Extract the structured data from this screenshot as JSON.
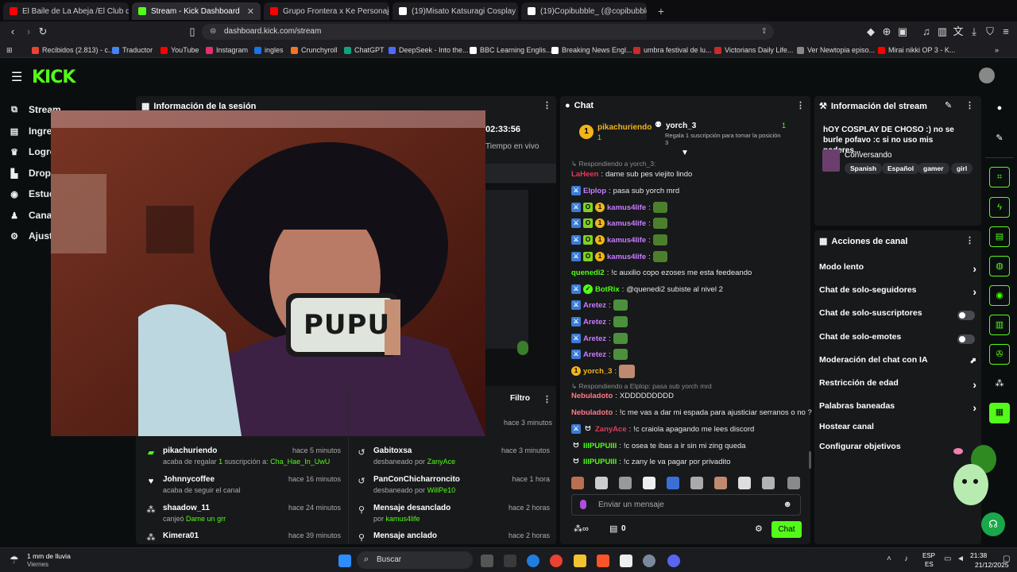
{
  "browser": {
    "tabs": [
      {
        "title": "El Baile de La Abeja /El Club de Kids",
        "icon": "youtube-icon",
        "color": "#ff0000"
      },
      {
        "title": "Stream - Kick Dashboard",
        "icon": "kick-icon",
        "color": "#53fc18"
      },
      {
        "title": "Grupo Frontera x Ke Personajes",
        "icon": "youtube-icon",
        "color": "#ff0000"
      },
      {
        "title": "(19)Misato Katsuragi Cosplay Highlig",
        "icon": "tiktok-icon",
        "color": "#ffffff"
      },
      {
        "title": "(19)Copibubble_ (@copibubble_) | T",
        "icon": "tiktok-icon",
        "color": "#ffffff"
      }
    ],
    "url": "dashboard.kick.com/stream",
    "bookmarks": [
      {
        "label": "Recibidos (2.813) - c...",
        "color": "#ea4335"
      },
      {
        "label": "Traductor",
        "color": "#4285f4"
      },
      {
        "label": "YouTube",
        "color": "#ff0000"
      },
      {
        "label": "Instagram",
        "color": "#e1306c"
      },
      {
        "label": "ingles",
        "color": "#1a73e8"
      },
      {
        "label": "Crunchyroll",
        "color": "#f47521"
      },
      {
        "label": "ChatGPT",
        "color": "#10a37f"
      },
      {
        "label": "DeepSeek - Into the...",
        "color": "#4d6bfe"
      },
      {
        "label": "BBC Learning Englis...",
        "color": "#ffffff"
      },
      {
        "label": "Breaking News Engl...",
        "color": "#ffffff"
      },
      {
        "label": "umbra festival de lu...",
        "color": "#c92a2a"
      },
      {
        "label": "Victorians Daily Life...",
        "color": "#c92a2a"
      },
      {
        "label": "Ver Newtopia episo...",
        "color": "#888888"
      },
      {
        "label": "Mirai nikki OP 3 - K...",
        "color": "#ff0000"
      }
    ]
  },
  "kick": {
    "logo": "KICK",
    "sidebar": [
      {
        "label": "Stream",
        "icon": "stream-icon"
      },
      {
        "label": "Ingres",
        "icon": "dollar-icon"
      },
      {
        "label": "Logro",
        "icon": "trophy-icon"
      },
      {
        "label": "Drops",
        "icon": "drops-icon"
      },
      {
        "label": "Estud",
        "icon": "studio-icon"
      },
      {
        "label": "Canal",
        "icon": "channel-icon"
      },
      {
        "label": "Ajust",
        "icon": "gear-icon"
      }
    ],
    "session": {
      "title": "Información de la sesión",
      "time": "02:33:56",
      "live_label": "Tiempo en vivo"
    },
    "overlay_text": "PUPU",
    "events": [
      {
        "name": "pikachuriendo",
        "time": "hace 5 minutos",
        "sub": "acaba de regalar",
        "highlight": "1",
        "sub2": "suscripción a:",
        "target": "Cha_Hae_In_UwU",
        "icon": "gift-icon"
      },
      {
        "name": "Johnnycoffee",
        "time": "hace 16 minutos",
        "sub": "acaba de seguir el canal",
        "icon": "heart-icon"
      },
      {
        "name": "shaadow_11",
        "time": "hace 24 minutos",
        "sub": "canjeó",
        "target": "Dame un grr",
        "icon": "redeem-icon"
      },
      {
        "name": "Kimera01",
        "time": "hace 39 minutos",
        "icon": "redeem-icon"
      }
    ],
    "mod_log": {
      "filter_label": "Filtro",
      "top_time": "hace 3 minutos",
      "rows": [
        {
          "name": "Gabitoxsa",
          "time": "hace 3 minutos",
          "sub": "desbaneado por",
          "by": "ZanyAce",
          "icon": "undo-icon"
        },
        {
          "name": "PanConChicharroncito",
          "time": "hace 1 hora",
          "sub": "desbaneado por",
          "by": "WillPe10",
          "icon": "undo-icon"
        },
        {
          "name": "Mensaje desanclado",
          "time": "hace 2 horas",
          "sub": "por",
          "by": "kamus4life",
          "icon": "unpin-icon"
        },
        {
          "name": "Mensaje anclado",
          "time": "hace 2 horas",
          "icon": "pin-icon"
        }
      ]
    },
    "chat": {
      "title": "Chat",
      "gifter": {
        "name": "pikachuriendo",
        "count": "1"
      },
      "gift_target": {
        "name": "yorch_3",
        "count": "1",
        "note": "Regala 1 suscripción para tomar la posición 3"
      },
      "messages": [
        {
          "type": "reply",
          "text": "Respondiendo a yorch_3:"
        },
        {
          "user": "LaHeen",
          "color": "#e23b5a",
          "text": "dame sub pes viejito lindo",
          "badges": []
        },
        {
          "user": "Elplop",
          "color": "#c77dff",
          "text": "pasa sub yorch mrd",
          "badges": [
            "b-blue"
          ]
        },
        {
          "user": "kamus4life",
          "color": "#c77dff",
          "text": "",
          "badges": [
            "b-blue",
            "b-lime",
            "b-gold"
          ],
          "emote": true
        },
        {
          "user": "kamus4life",
          "color": "#c77dff",
          "text": "",
          "badges": [
            "b-blue",
            "b-lime",
            "b-gold"
          ],
          "emote": true
        },
        {
          "user": "kamus4life",
          "color": "#c77dff",
          "text": "",
          "badges": [
            "b-blue",
            "b-lime",
            "b-gold"
          ],
          "emote": true
        },
        {
          "user": "kamus4life",
          "color": "#c77dff",
          "text": "",
          "badges": [
            "b-blue",
            "b-lime",
            "b-gold"
          ],
          "emote": true
        },
        {
          "user": "quenedi2",
          "color": "#53fc18",
          "text": "!c auxilio copo ezoses me esta feedeando",
          "badges": []
        },
        {
          "user": "BotRix",
          "color": "#53fc18",
          "text": "@quenedi2 subiste al nivel 2",
          "badges": [
            "b-blue",
            "b-green"
          ]
        },
        {
          "user": "Aretez",
          "color": "#c77dff",
          "text": "",
          "badges": [
            "b-blue"
          ],
          "emote": true
        },
        {
          "user": "Aretez",
          "color": "#c77dff",
          "text": "",
          "badges": [
            "b-blue"
          ],
          "emote": true
        },
        {
          "user": "Aretez",
          "color": "#c77dff",
          "text": "",
          "badges": [
            "b-blue"
          ],
          "emote": true
        },
        {
          "user": "Aretez",
          "color": "#c77dff",
          "text": "",
          "badges": [
            "b-blue"
          ],
          "emote": true
        },
        {
          "user": "yorch_3",
          "color": "#f1b51a",
          "text": "",
          "badges": [
            "b-gold"
          ],
          "emote": true
        },
        {
          "type": "reply",
          "text": "Respondiendo a Elplop: pasa sub yorch mrd"
        },
        {
          "user": "Nebuladoto",
          "color": "#ff7a8a",
          "text": "XDDDDDDDDD",
          "badges": []
        },
        {
          "user": "Nebuladoto",
          "color": "#ff7a8a",
          "text": "!c me vas a dar mi espada para ajusticiar serranos o no ?",
          "badges": []
        },
        {
          "user": "ZanyAce",
          "color": "#e23b5a",
          "text": "!c craiola apagando me lees discord",
          "badges": [
            "b-blue",
            "b-blue"
          ]
        },
        {
          "user": "IIIPUPUIII",
          "color": "#53fc18",
          "text": "!c osea te ibas a ir sin mi zing queda",
          "badges": [
            "b-blue"
          ]
        },
        {
          "user": "IIIPUPUIII",
          "color": "#53fc18",
          "text": "!c zany le va pagar por privadito",
          "badges": [
            "b-blue"
          ]
        }
      ],
      "input_placeholder": "Enviar un mensaje",
      "points": "0",
      "send_label": "Chat"
    },
    "stream_info": {
      "title": "Información del stream",
      "stream_title": "hOY COSPLAY DE CHOSO :) no se burle pofavo :c si no uso mis poderes...",
      "category": "Conversando",
      "tags": [
        "Spanish",
        "Español",
        "gamer",
        "girl"
      ]
    },
    "channel_actions": {
      "title": "Acciones de canal",
      "items": [
        {
          "label": "Modo lento",
          "control": "chevron"
        },
        {
          "label": "Chat de solo-seguidores",
          "control": "chevron"
        },
        {
          "label": "Chat de solo-suscriptores",
          "control": "toggle"
        },
        {
          "label": "Chat de solo-emotes",
          "control": "toggle"
        },
        {
          "label": "Moderación del chat con IA",
          "control": "external"
        },
        {
          "label": "Restricción de edad",
          "control": "chevron"
        },
        {
          "label": "Palabras baneadas",
          "control": "chevron"
        },
        {
          "label": "Hostear canal",
          "control": "none"
        },
        {
          "label": "Configurar objetivos",
          "control": "none"
        }
      ]
    }
  },
  "taskbar": {
    "weather": "1 mm de lluvia",
    "weather_sub": "Viernes",
    "search": "Buscar",
    "lang": "ESP",
    "lang_sub": "ES",
    "time": "21:38",
    "date": "21/12/2025"
  }
}
